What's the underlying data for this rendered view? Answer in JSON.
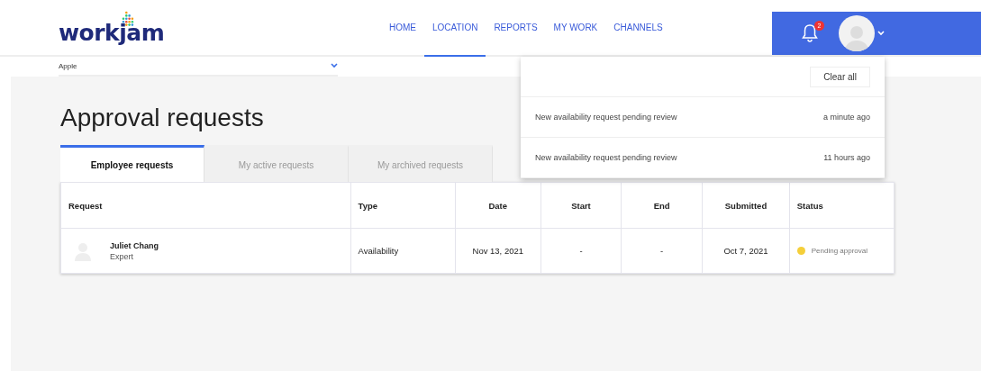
{
  "logo": {
    "text": "workjam"
  },
  "nav": [
    {
      "label": "HOME",
      "selected": false
    },
    {
      "label": "LOCATION",
      "selected": true
    },
    {
      "label": "REPORTS",
      "selected": false
    },
    {
      "label": "MY WORK",
      "selected": false
    },
    {
      "label": "CHANNELS",
      "selected": false
    }
  ],
  "notifications_badge": "2",
  "location_selector": {
    "value": "Apple"
  },
  "page_title": "Approval requests",
  "tabs": [
    {
      "label": "Employee requests",
      "selected": true
    },
    {
      "label": "My active requests",
      "selected": false
    },
    {
      "label": "My archived requests",
      "selected": false
    }
  ],
  "table": {
    "columns": [
      "Request",
      "Type",
      "Date",
      "Start",
      "End",
      "Submitted",
      "Status"
    ],
    "rows": [
      {
        "name": "Juliet Chang",
        "role": "Expert",
        "type": "Availability",
        "date": "Nov 13, 2021",
        "start": "-",
        "end": "-",
        "submitted": "Oct 7, 2021",
        "status": "Pending approval",
        "color": "#f5cf3a"
      }
    ]
  },
  "notifications_panel": {
    "clear_button": "Clear all",
    "items": [
      {
        "message": "New availability request pending review",
        "time": "a minute ago"
      },
      {
        "message": "New availability request pending review",
        "time": "11 hours ago"
      }
    ]
  }
}
